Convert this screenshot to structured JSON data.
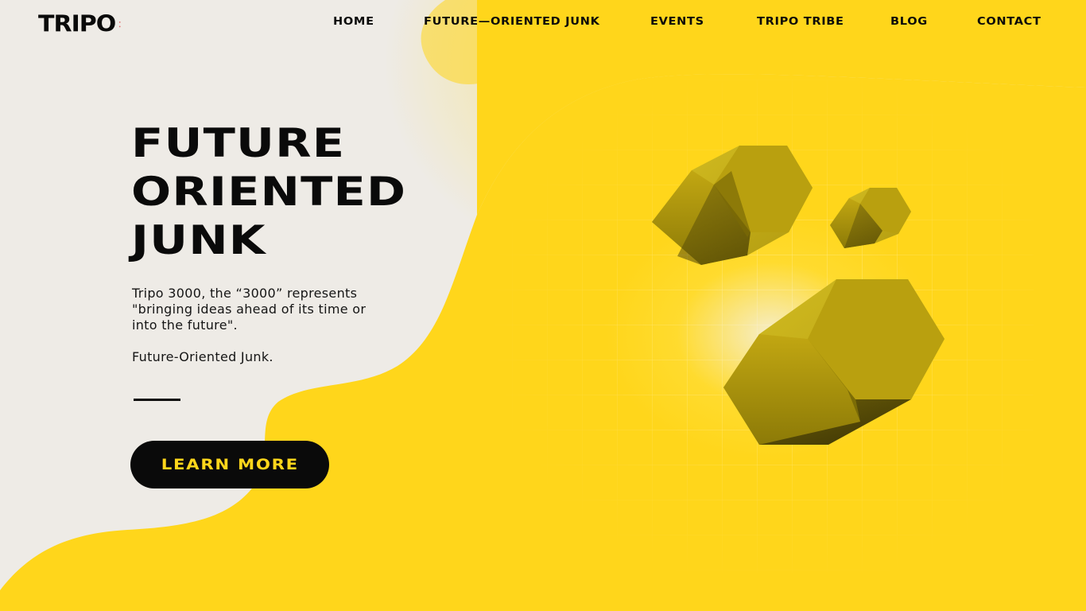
{
  "brand": {
    "logo_text": "TRIPO",
    "accent_color": "#ffd61b",
    "background_color": "#eeebe6",
    "text_color": "#0a0a0a"
  },
  "nav": {
    "items": [
      {
        "label": "HOME"
      },
      {
        "label": "FUTURE—ORIENTED JUNK"
      },
      {
        "label": "EVENTS"
      },
      {
        "label": "TRIPO TRIBE"
      },
      {
        "label": "BLOG"
      },
      {
        "label": "CONTACT"
      }
    ]
  },
  "hero": {
    "title_lines": [
      "FUTURE",
      "ORIENTED",
      "JUNK"
    ],
    "description": "Tripo 3000, the “3000” represents \"bringing ideas ahead of its time or into the future\".",
    "tagline": "Future-Oriented Junk.",
    "cta_label": "LEARN MORE"
  },
  "illustration": {
    "icons": [
      "hexagonal-prism-icon",
      "hexagonal-prism-icon",
      "hexagonal-prism-icon"
    ]
  }
}
